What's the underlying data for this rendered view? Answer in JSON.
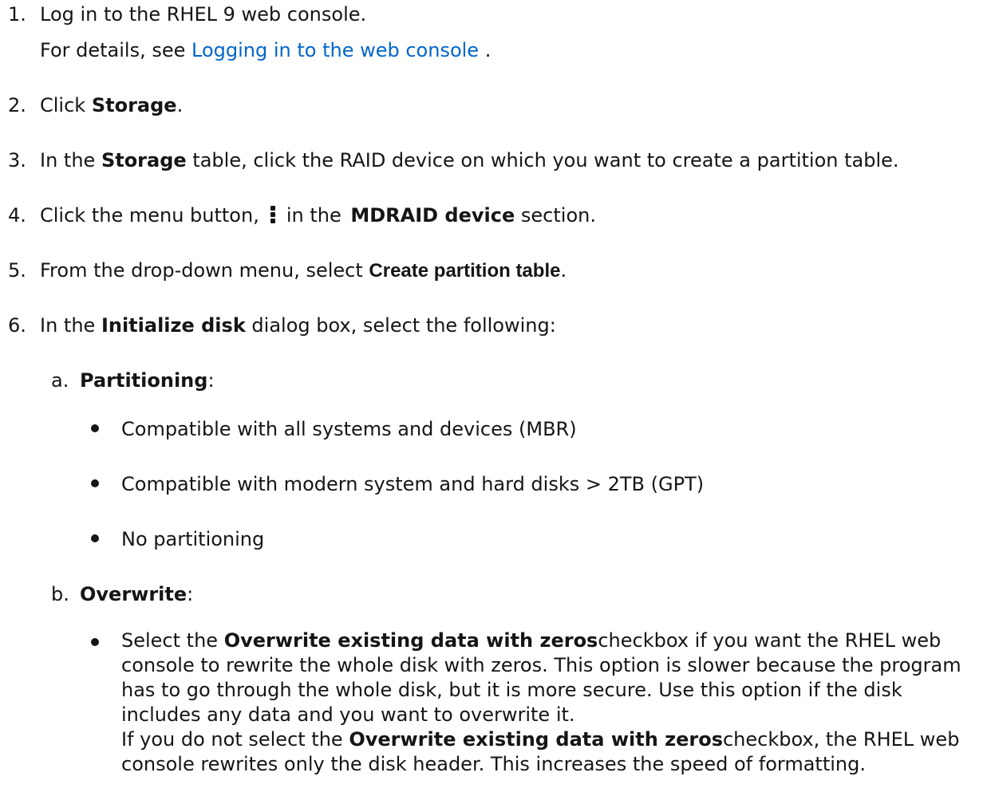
{
  "steps": [
    {
      "num": "1.",
      "line1": "Log in to the RHEL 9 web console.",
      "line2_pre": "For details, see ",
      "link": "Logging in to the web console",
      "line2_post": " ."
    },
    {
      "num": "2.",
      "pre": "Click ",
      "bold": "Storage",
      "post": "."
    },
    {
      "num": "3.",
      "pre": "In the ",
      "bold": "Storage",
      "post": " table, click the RAID device on which you want to create a partition table."
    },
    {
      "num": "4.",
      "pre": "Click the menu button,",
      "icon": "kebab-menu-icon",
      "mid": "in the ",
      "bold": "MDRAID device",
      "post": " section."
    },
    {
      "num": "5.",
      "pre": "From the drop-down menu, select ",
      "bold": "Create partition table",
      "post": "."
    },
    {
      "num": "6.",
      "pre": "In the ",
      "bold": "Initialize disk",
      "post": " dialog box, select the following:"
    }
  ],
  "substeps": {
    "a": {
      "num": "a.",
      "bold": "Partitioning",
      "post": ":",
      "bullets": [
        "Compatible with all systems and devices (MBR)",
        "Compatible with modern system and hard disks > 2TB (GPT)",
        "No partitioning"
      ]
    },
    "b": {
      "num": "b.",
      "bold": "Overwrite",
      "post": ":",
      "bullet": {
        "l1_pre": "Select the ",
        "l1_bold": "Overwrite existing data with zeros",
        "l1_post": "checkbox if you want the RHEL web",
        "l2": "console to rewrite the whole disk with zeros. This option is slower because the program",
        "l3": "has to go through the whole disk, but it is more secure. Use this option if the disk",
        "l4": "includes any data and you want to overwrite it.",
        "l5_pre": "If you do not select the ",
        "l5_bold": "Overwrite existing data with zeros",
        "l5_post": "checkbox, the RHEL web",
        "l6": "console rewrites only the disk header. This increases the speed of formatting."
      }
    }
  },
  "colors": {
    "text": "#151515",
    "link": "#0066cc"
  }
}
